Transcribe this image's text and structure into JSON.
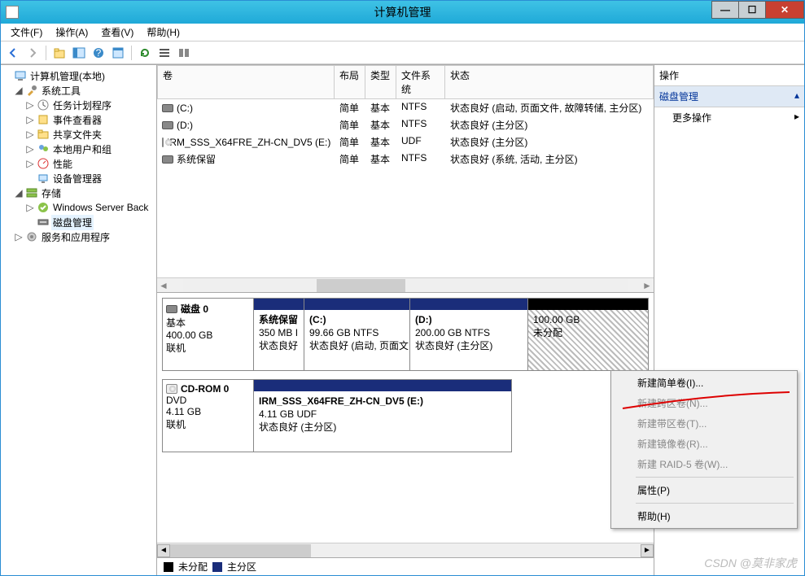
{
  "window": {
    "title": "计算机管理"
  },
  "sysbtns": {
    "min": "—",
    "max": "☐",
    "close": "✕"
  },
  "menu": {
    "file": "文件(F)",
    "action": "操作(A)",
    "view": "查看(V)",
    "help": "帮助(H)"
  },
  "tree": {
    "root": "计算机管理(本地)",
    "systools": "系统工具",
    "taskSched": "任务计划程序",
    "eventViewer": "事件查看器",
    "sharedFolders": "共享文件夹",
    "localUsers": "本地用户和组",
    "perf": "性能",
    "devmgr": "设备管理器",
    "storage": "存储",
    "wsb": "Windows Server Back",
    "diskmgmt": "磁盘管理",
    "services": "服务和应用程序"
  },
  "volHeader": {
    "vol": "卷",
    "layout": "布局",
    "type": "类型",
    "fs": "文件系统",
    "status": "状态"
  },
  "vols": [
    {
      "icon": "disk",
      "name": "(C:)",
      "layout": "简单",
      "type": "基本",
      "fs": "NTFS",
      "status": "状态良好 (启动, 页面文件, 故障转储, 主分区)"
    },
    {
      "icon": "disk",
      "name": "(D:)",
      "layout": "简单",
      "type": "基本",
      "fs": "NTFS",
      "status": "状态良好 (主分区)"
    },
    {
      "icon": "cd",
      "name": "IRM_SSS_X64FRE_ZH-CN_DV5 (E:)",
      "layout": "简单",
      "type": "基本",
      "fs": "UDF",
      "status": "状态良好 (主分区)"
    },
    {
      "icon": "disk",
      "name": "系统保留",
      "layout": "简单",
      "type": "基本",
      "fs": "NTFS",
      "status": "状态良好 (系统, 活动, 主分区)"
    }
  ],
  "disk0": {
    "name": "磁盘 0",
    "type": "基本",
    "size": "400.00 GB",
    "status": "联机",
    "p0": {
      "title": "系统保留",
      "size": "350 MB I",
      "stat": "状态良好"
    },
    "p1": {
      "title": "(C:)",
      "size": "99.66 GB NTFS",
      "stat": "状态良好 (启动, 页面文"
    },
    "p2": {
      "title": "(D:)",
      "size": "200.00 GB NTFS",
      "stat": "状态良好 (主分区)"
    },
    "p3": {
      "size": "100.00 GB",
      "stat": "未分配"
    }
  },
  "cdrom0": {
    "name": "CD-ROM 0",
    "type": "DVD",
    "size": "4.11 GB",
    "status": "联机",
    "p0": {
      "title": "IRM_SSS_X64FRE_ZH-CN_DV5   (E:)",
      "size": "4.11 GB UDF",
      "stat": "状态良好 (主分区)"
    }
  },
  "legend": {
    "unalloc": "未分配",
    "primary": "主分区"
  },
  "actions": {
    "title": "操作",
    "diskmgmt": "磁盘管理",
    "more": "更多操作"
  },
  "ctx": {
    "newSimple": "新建简单卷(I)...",
    "newSpan": "新建跨区卷(N)...",
    "newStripe": "新建带区卷(T)...",
    "newMirror": "新建镜像卷(R)...",
    "newRaid5": "新建 RAID-5 卷(W)...",
    "props": "属性(P)",
    "help": "帮助(H)"
  },
  "watermark": "CSDN @莫非家虎"
}
